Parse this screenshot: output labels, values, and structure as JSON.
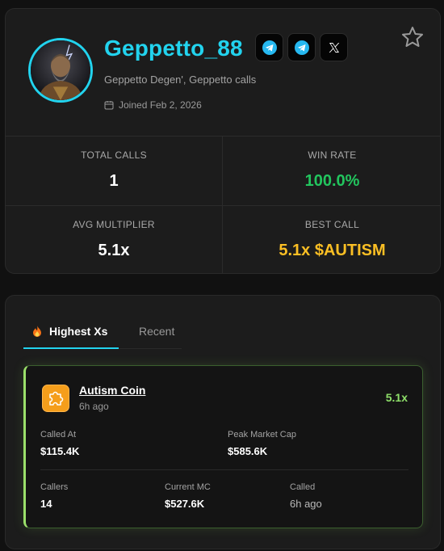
{
  "profile": {
    "username": "Geppetto_88",
    "bio": "Geppetto Degen', Geppetto calls",
    "joined": "Joined Feb 2, 2026",
    "socials": [
      {
        "icon": "telegram-icon"
      },
      {
        "icon": "telegram-icon"
      },
      {
        "icon": "x-icon"
      }
    ],
    "favorite_icon": "star-icon"
  },
  "stats": {
    "total_calls": {
      "label": "TOTAL CALLS",
      "value": "1"
    },
    "win_rate": {
      "label": "WIN RATE",
      "value": "100.0%"
    },
    "avg_multiplier": {
      "label": "AVG MULTIPLIER",
      "value": "5.1x"
    },
    "best_call": {
      "label": "BEST CALL",
      "value": "5.1x $AUTISM"
    }
  },
  "tabs": {
    "highest": "Highest Xs",
    "recent": "Recent"
  },
  "call": {
    "coin_name": "Autism Coin",
    "age": "6h ago",
    "multiplier": "5.1x",
    "called_at_label": "Called At",
    "called_at_value": "$115.4K",
    "peak_mc_label": "Peak Market Cap",
    "peak_mc_value": "$585.6K",
    "callers_label": "Callers",
    "callers_value": "14",
    "current_mc_label": "Current MC",
    "current_mc_value": "$527.6K",
    "called_label": "Called",
    "called_value": "6h ago"
  },
  "colors": {
    "accent": "#22d3ee",
    "positive": "#22c55e",
    "best_call": "#fbbf24",
    "card_glow": "#9be06a"
  }
}
